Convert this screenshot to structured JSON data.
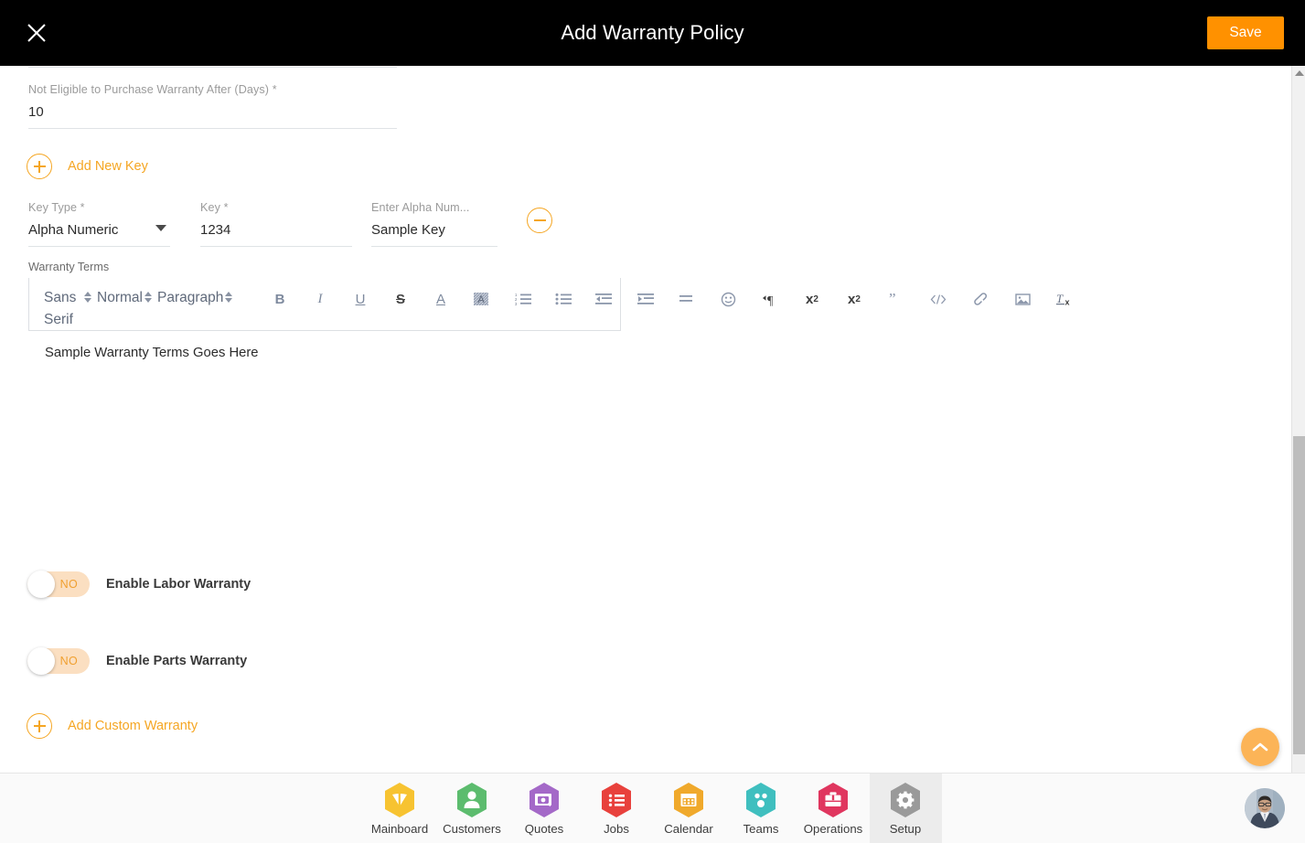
{
  "header": {
    "title": "Add Warranty Policy",
    "close_icon": "close-icon",
    "save_label": "Save"
  },
  "form": {
    "days_field": {
      "label": "Not Eligible to Purchase Warranty After (Days) *",
      "value": "10"
    },
    "add_new_key_label": "Add New Key",
    "add_new_key_icon": "plus-circle-icon",
    "remove_key_icon": "minus-circle-icon",
    "key_row": {
      "key_type": {
        "label": "Key Type *",
        "value": "Alpha Numeric",
        "caret_icon": "chevron-down-icon"
      },
      "key": {
        "label": "Key *",
        "value": "1234"
      },
      "alpha": {
        "label": "Enter Alpha Num...",
        "value": "Sample Key"
      }
    },
    "warranty_terms": {
      "caption": "Warranty Terms",
      "body_text": "Sample Warranty Terms Goes Here",
      "toolbar": {
        "font_family": "Sans Serif",
        "font_size": "Normal",
        "block_format": "Paragraph",
        "buttons": [
          {
            "name": "bold-icon",
            "label": "B"
          },
          {
            "name": "italic-icon",
            "label": "I"
          },
          {
            "name": "underline-icon",
            "label": "U"
          },
          {
            "name": "strikethrough-icon",
            "label": "S"
          },
          {
            "name": "font-color-icon",
            "label": "A"
          },
          {
            "name": "highlight-color-icon",
            "label": "A"
          },
          {
            "name": "ordered-list-icon",
            "label": ""
          },
          {
            "name": "bullet-list-icon",
            "label": ""
          },
          {
            "name": "outdent-icon",
            "label": ""
          },
          {
            "name": "indent-icon",
            "label": ""
          },
          {
            "name": "align-icon",
            "label": ""
          },
          {
            "name": "emoji-icon",
            "label": ""
          },
          {
            "name": "text-direction-icon",
            "label": ""
          },
          {
            "name": "subscript-icon",
            "label": "x"
          },
          {
            "name": "superscript-icon",
            "label": "x"
          },
          {
            "name": "blockquote-icon",
            "label": ""
          },
          {
            "name": "code-block-icon",
            "label": ""
          },
          {
            "name": "link-icon",
            "label": ""
          },
          {
            "name": "image-icon",
            "label": ""
          },
          {
            "name": "clear-format-icon",
            "label": ""
          }
        ]
      }
    },
    "toggles": [
      {
        "name": "enable-labor-warranty",
        "state_label": "NO",
        "label": "Enable Labor Warranty"
      },
      {
        "name": "enable-parts-warranty",
        "state_label": "NO",
        "label": "Enable Parts Warranty"
      }
    ],
    "add_custom_warranty_label": "Add Custom Warranty",
    "add_custom_warranty_icon": "plus-circle-icon"
  },
  "scroll_top_button": {
    "icon": "chevron-up-icon"
  },
  "scrollbar": {
    "up_icon": "caret-up-icon",
    "down_icon": "caret-down-icon"
  },
  "bottom_nav": {
    "items": [
      {
        "label": "Mainboard",
        "icon": "mainboard-icon",
        "color": "#F7C331",
        "active": false
      },
      {
        "label": "Customers",
        "icon": "customers-icon",
        "color": "#5CBC6E",
        "active": false
      },
      {
        "label": "Quotes",
        "icon": "quotes-icon",
        "color": "#A469C8",
        "active": false
      },
      {
        "label": "Jobs",
        "icon": "jobs-icon",
        "color": "#E8413C",
        "active": false
      },
      {
        "label": "Calendar",
        "icon": "calendar-icon",
        "color": "#F0A92B",
        "active": false
      },
      {
        "label": "Teams",
        "icon": "teams-icon",
        "color": "#3FBFBF",
        "active": false
      },
      {
        "label": "Operations",
        "icon": "operations-icon",
        "color": "#E0365F",
        "active": false
      },
      {
        "label": "Setup",
        "icon": "setup-icon",
        "color": "#9A9A9A",
        "active": true
      }
    ],
    "avatar": "user-avatar"
  },
  "colors": {
    "accent": "#F5A623",
    "save_orange": "#FF9100",
    "header_bg": "#000000"
  }
}
